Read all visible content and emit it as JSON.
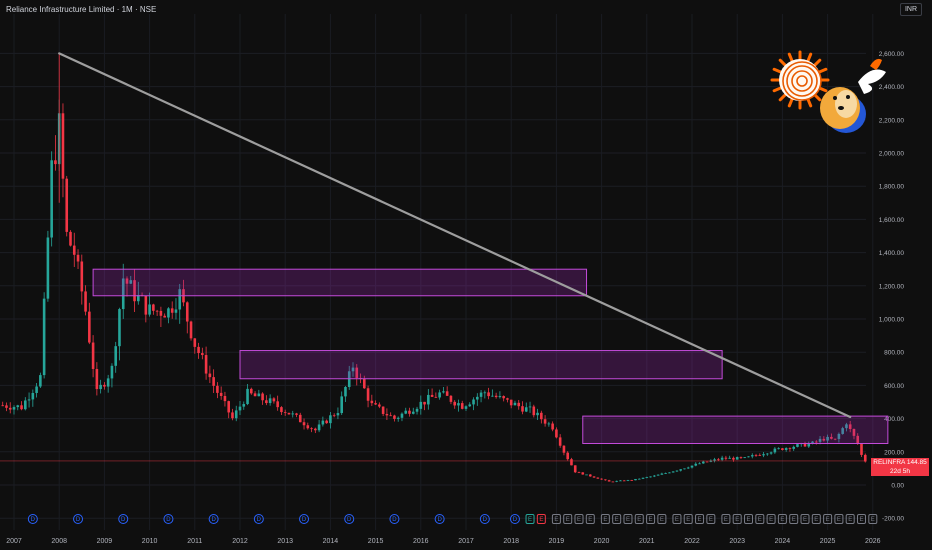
{
  "header": {
    "title": "Reliance Infrastructure Limited · 1M · NSE",
    "currency": "INR"
  },
  "price_tag": {
    "symbol": "RELINFRA",
    "price": "144.85",
    "countdown": "22d 5h"
  },
  "colors": {
    "background": "#0f0f0f",
    "up": "#26a69a",
    "down": "#f23645",
    "trendline": "#9e9e9e",
    "zone": "#9c27b0",
    "price_line": "#f23645"
  },
  "chart_data": {
    "type": "candlestick",
    "title": "Reliance Infrastructure Limited · 1M · NSE",
    "xlabel": "",
    "ylabel": "",
    "x_ticks": [
      "2007",
      "2008",
      "2009",
      "2010",
      "2011",
      "2012",
      "2013",
      "2014",
      "2015",
      "2016",
      "2017",
      "2018",
      "2019",
      "2020",
      "2021",
      "2022",
      "2023",
      "2024",
      "2025",
      "2026"
    ],
    "y_ticks": [
      "2,600.00",
      "2,400.00",
      "2,200.00",
      "2,000.00",
      "1,800.00",
      "1,600.00",
      "1,400.00",
      "1,200.00",
      "1,000.00",
      "800.00",
      "600.00",
      "400.00",
      "200.00",
      "0.00",
      "-200.00"
    ],
    "ylim": [
      -200,
      2750
    ],
    "grid": true,
    "last_price": 144.85,
    "price_path": [
      [
        "2006-10-01",
        480
      ],
      [
        "2007-03-01",
        470
      ],
      [
        "2007-08-01",
        650
      ],
      [
        "2007-11-01",
        1900
      ],
      [
        "2008-01-01",
        2150
      ],
      [
        "2008-03-01",
        1500
      ],
      [
        "2008-05-01",
        1400
      ],
      [
        "2008-08-01",
        1050
      ],
      [
        "2008-11-01",
        550
      ],
      [
        "2009-03-01",
        700
      ],
      [
        "2009-06-01",
        1250
      ],
      [
        "2009-09-01",
        1150
      ],
      [
        "2010-01-01",
        1050
      ],
      [
        "2010-06-01",
        1050
      ],
      [
        "2010-09-01",
        1150
      ],
      [
        "2011-01-01",
        850
      ],
      [
        "2011-06-01",
        600
      ],
      [
        "2011-11-01",
        400
      ],
      [
        "2012-03-01",
        550
      ],
      [
        "2012-09-01",
        500
      ],
      [
        "2013-03-01",
        420
      ],
      [
        "2013-09-01",
        330
      ],
      [
        "2014-03-01",
        450
      ],
      [
        "2014-07-01",
        720
      ],
      [
        "2014-12-01",
        480
      ],
      [
        "2015-06-01",
        400
      ],
      [
        "2015-12-01",
        480
      ],
      [
        "2016-06-01",
        550
      ],
      [
        "2016-12-01",
        480
      ],
      [
        "2017-06-01",
        560
      ],
      [
        "2017-12-01",
        500
      ],
      [
        "2018-06-01",
        450
      ],
      [
        "2018-12-01",
        350
      ],
      [
        "2019-03-01",
        200
      ],
      [
        "2019-06-01",
        80
      ],
      [
        "2019-12-01",
        40
      ],
      [
        "2020-03-01",
        20
      ],
      [
        "2020-09-01",
        30
      ],
      [
        "2021-03-01",
        55
      ],
      [
        "2021-09-01",
        90
      ],
      [
        "2022-03-01",
        130
      ],
      [
        "2022-09-01",
        160
      ],
      [
        "2023-03-01",
        160
      ],
      [
        "2023-09-01",
        200
      ],
      [
        "2024-03-01",
        230
      ],
      [
        "2024-09-01",
        250
      ],
      [
        "2024-12-01",
        280
      ],
      [
        "2025-03-01",
        270
      ],
      [
        "2025-05-01",
        340
      ],
      [
        "2025-06-01",
        380
      ],
      [
        "2025-07-01",
        330
      ],
      [
        "2025-09-01",
        250
      ],
      [
        "2025-10-01",
        180
      ],
      [
        "2025-11-01",
        144.85
      ]
    ],
    "trendline": {
      "from": [
        "2008-01-01",
        2600
      ],
      "to": [
        "2025-07-01",
        410
      ]
    },
    "zones": [
      {
        "start": "2008-10-01",
        "end": "2019-09-01",
        "low": 1140,
        "high": 1300
      },
      {
        "start": "2012-01-01",
        "end": "2022-09-01",
        "low": 640,
        "high": 810
      },
      {
        "start": "2019-08-01",
        "end": "2026-05-01",
        "low": 250,
        "high": 415
      }
    ],
    "event_markers": [
      {
        "date": "2007-06-01",
        "label": "D",
        "kind": "dividend"
      },
      {
        "date": "2008-06-01",
        "label": "D",
        "kind": "dividend"
      },
      {
        "date": "2009-06-01",
        "label": "D",
        "kind": "dividend"
      },
      {
        "date": "2010-06-01",
        "label": "D",
        "kind": "dividend"
      },
      {
        "date": "2011-06-01",
        "label": "D",
        "kind": "dividend"
      },
      {
        "date": "2012-06-01",
        "label": "D",
        "kind": "dividend"
      },
      {
        "date": "2013-06-01",
        "label": "D",
        "kind": "dividend"
      },
      {
        "date": "2014-06-01",
        "label": "D",
        "kind": "dividend"
      },
      {
        "date": "2015-06-01",
        "label": "D",
        "kind": "dividend"
      },
      {
        "date": "2016-06-01",
        "label": "D",
        "kind": "dividend"
      },
      {
        "date": "2017-06-01",
        "label": "D",
        "kind": "dividend"
      },
      {
        "date": "2018-02-01",
        "label": "D",
        "kind": "dividend"
      },
      {
        "date": "2018-06-01",
        "label": "E",
        "kind": "earnings-up"
      },
      {
        "date": "2018-09-01",
        "label": "E",
        "kind": "earnings-down"
      },
      {
        "date": "2019-01-01",
        "label": "E",
        "kind": "earnings"
      },
      {
        "date": "2019-04-01",
        "label": "E",
        "kind": "earnings"
      },
      {
        "date": "2019-07-01",
        "label": "E",
        "kind": "earnings"
      },
      {
        "date": "2019-10-01",
        "label": "E",
        "kind": "earnings"
      },
      {
        "date": "2020-02-01",
        "label": "E",
        "kind": "earnings"
      },
      {
        "date": "2020-05-01",
        "label": "E",
        "kind": "earnings"
      },
      {
        "date": "2020-08-01",
        "label": "E",
        "kind": "earnings"
      },
      {
        "date": "2020-11-01",
        "label": "E",
        "kind": "earnings"
      },
      {
        "date": "2021-02-01",
        "label": "E",
        "kind": "earnings"
      },
      {
        "date": "2021-05-01",
        "label": "E",
        "kind": "earnings"
      },
      {
        "date": "2021-09-01",
        "label": "E",
        "kind": "earnings"
      },
      {
        "date": "2021-12-01",
        "label": "E",
        "kind": "earnings"
      },
      {
        "date": "2022-03-01",
        "label": "E",
        "kind": "earnings"
      },
      {
        "date": "2022-06-01",
        "label": "E",
        "kind": "earnings"
      },
      {
        "date": "2022-10-01",
        "label": "E",
        "kind": "earnings"
      },
      {
        "date": "2023-01-01",
        "label": "E",
        "kind": "earnings"
      },
      {
        "date": "2023-04-01",
        "label": "E",
        "kind": "earnings"
      },
      {
        "date": "2023-07-01",
        "label": "E",
        "kind": "earnings"
      },
      {
        "date": "2023-10-01",
        "label": "E",
        "kind": "earnings"
      },
      {
        "date": "2024-01-01",
        "label": "E",
        "kind": "earnings"
      },
      {
        "date": "2024-04-01",
        "label": "E",
        "kind": "earnings"
      },
      {
        "date": "2024-07-01",
        "label": "E",
        "kind": "earnings"
      },
      {
        "date": "2024-10-01",
        "label": "E",
        "kind": "earnings"
      },
      {
        "date": "2025-01-01",
        "label": "E",
        "kind": "earnings"
      },
      {
        "date": "2025-04-01",
        "label": "E",
        "kind": "earnings"
      },
      {
        "date": "2025-07-01",
        "label": "E",
        "kind": "earnings"
      },
      {
        "date": "2025-10-01",
        "label": "E",
        "kind": "earnings"
      },
      {
        "date": "2026-01-01",
        "label": "E",
        "kind": "earnings"
      }
    ]
  }
}
